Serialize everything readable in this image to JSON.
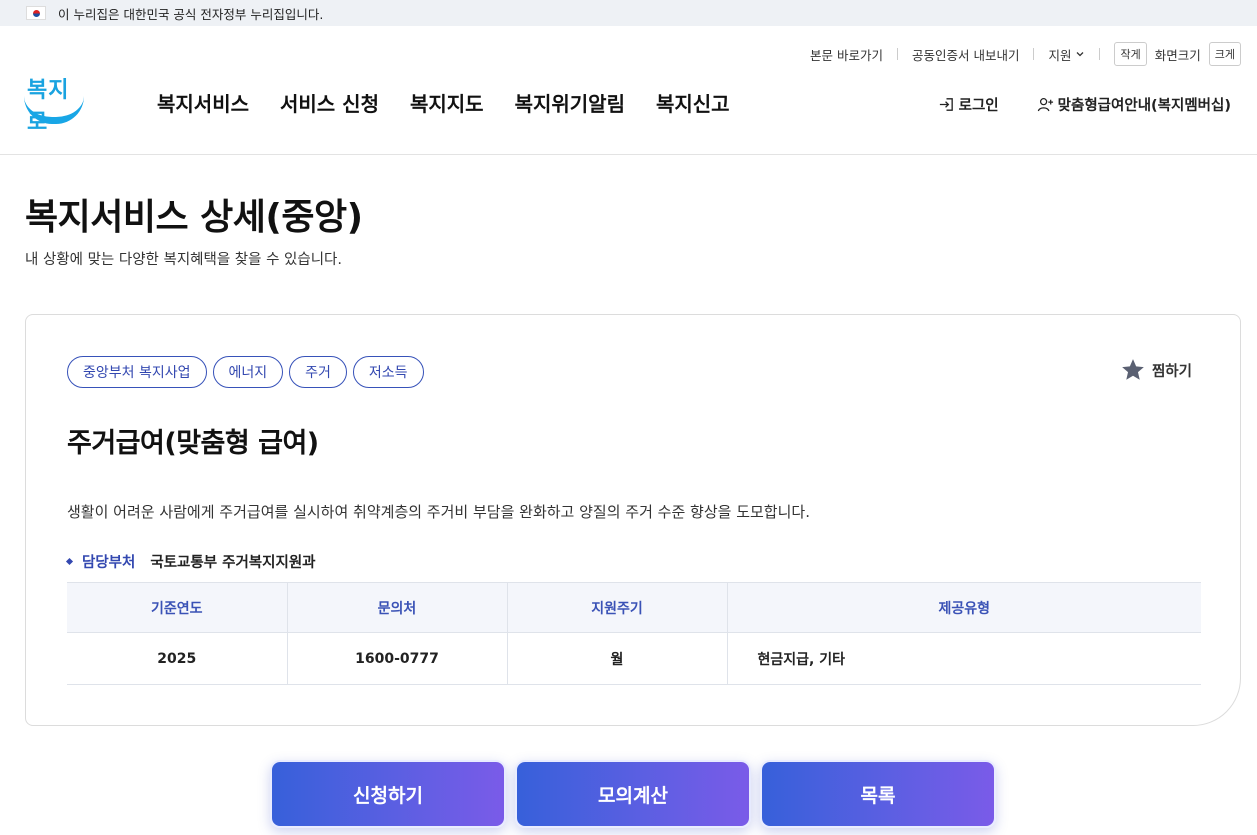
{
  "gov_banner": {
    "text": "이 누리집은 대한민국 공식 전자정부 누리집입니다."
  },
  "utility": {
    "skip_link": "본문 바로가기",
    "cert_export": "공동인증서 내보내기",
    "support": "지원",
    "zoom_small": "작게",
    "zoom_label": "화면크기",
    "zoom_large": "크게"
  },
  "logo": {
    "text": "복지로"
  },
  "gnb": [
    "복지서비스",
    "서비스 신청",
    "복지지도",
    "복지위기알림",
    "복지신고"
  ],
  "header_actions": {
    "login": "로그인",
    "membership": "맞춤형급여안내(복지멤버십)"
  },
  "page": {
    "title": "복지서비스 상세(중앙)",
    "subtitle": "내 상황에 맞는 다양한 복지혜택을 찾을 수 있습니다."
  },
  "service": {
    "tags": [
      "중앙부처 복지사업",
      "에너지",
      "주거",
      "저소득"
    ],
    "favorite": "찜하기",
    "title": "주거급여(맞춤형 급여)",
    "description": "생활이 어려운 사람에게 주거급여를 실시하여 취약계층의 주거비 부담을 완화하고 양질의 주거 수준 향상을 도모합니다.",
    "dept_label": "담당부처",
    "dept_value": "국토교통부 주거복지지원과",
    "table": {
      "headers": [
        "기준연도",
        "문의처",
        "지원주기",
        "제공유형"
      ],
      "row": [
        "2025",
        "1600-0777",
        "월",
        "현금지급, 기타"
      ]
    }
  },
  "buttons": {
    "apply": "신청하기",
    "simulate": "모의계산",
    "list": "목록"
  },
  "colors": {
    "accent": "#3348b0",
    "logo_blue": "#1aa3e0",
    "button_gradient_start": "#3760da",
    "button_gradient_end": "#7a5be8"
  }
}
